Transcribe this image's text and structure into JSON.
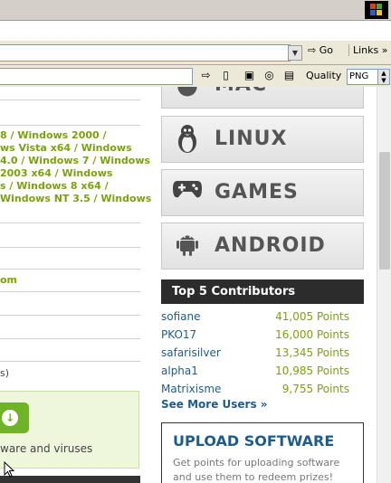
{
  "browser": {
    "go_label": "Go",
    "links_label": "Links",
    "quality_label": "Quality",
    "quality_value": "PNG"
  },
  "left": {
    "os_lines": [
      "8 / Windows 2000 /",
      "ws Vista x64 / Windows",
      "4.0 / Windows 7 / Windows",
      " 2003 x64 / Windows",
      "s / Windows 8 x64 /",
      "Windows NT 3.5 / Windows"
    ],
    "green_link": "om",
    "paren_text": "s)",
    "viruses_text": "ware and viruses"
  },
  "platforms": [
    {
      "label": "MAC",
      "icon": "apple-icon"
    },
    {
      "label": "LINUX",
      "icon": "tux-icon"
    },
    {
      "label": "GAMES",
      "icon": "gamepad-icon"
    },
    {
      "label": "ANDROID",
      "icon": "android-icon"
    }
  ],
  "contributors": {
    "title": "Top 5 Contributors",
    "rows": [
      {
        "user": "sofiane",
        "points": "41,005 Points"
      },
      {
        "user": "PKO17",
        "points": "16,000 Points"
      },
      {
        "user": "safarisilver",
        "points": "13,345 Points"
      },
      {
        "user": "alpha1",
        "points": "10,985 Points"
      },
      {
        "user": "Matrixisme",
        "points": "9,755 Points"
      }
    ],
    "see_more": "See More Users »"
  },
  "upload": {
    "title": "UPLOAD SOFTWARE",
    "desc": "Get points for uploading software and use them to redeem prizes!"
  }
}
